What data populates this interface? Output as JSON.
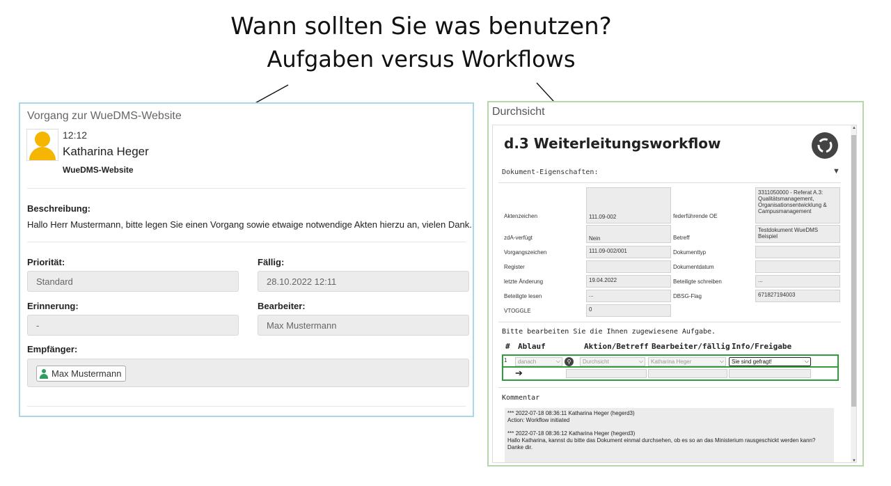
{
  "heading": {
    "line1": "Wann sollten Sie was benutzen?",
    "line2": "Aufgaben versus Workflows"
  },
  "left": {
    "panel_title": "Vorgang zur WueDMS-Website",
    "time": "12:12",
    "user": "Katharina Heger",
    "subject": "WueDMS-Website",
    "description_label": "Beschreibung:",
    "description": "Hallo Herr Mustermann, bitte legen Sie einen Vorgang sowie etwaige notwendige Akten hierzu an, vielen Dank.",
    "priority_label": "Priorität:",
    "priority": "Standard",
    "due_label": "Fällig:",
    "due": "28.10.2022 12:11",
    "reminder_label": "Erinnerung:",
    "reminder": "-",
    "editor_label": "Bearbeiter:",
    "editor": "Max Mustermann",
    "recipient_label": "Empfänger:",
    "recipient": "Max Mustermann",
    "accent_color": "#f5b500"
  },
  "right": {
    "panel_title": "Durchsicht",
    "workflow_title": "d.3 Weiterleitungsworkflow",
    "doc_props_label": "Dokument-Eigenschaften:",
    "props": {
      "aktenzeichen_label": "Aktenzeichen",
      "aktenzeichen": "111.09-002",
      "oe_label": "federführende OE",
      "oe": "3311050000 - Referat A.3: Qualitätsmanagement, Organisationsentwicklung & Campusmanagement",
      "zda_label": "zdA-verfügt",
      "zda": "Nein",
      "betreff_label": "Betreff",
      "betreff": "Testdokument WueDMS Beispiel",
      "vorgang_label": "Vorgangszeichen",
      "vorgang": "111.09-002/001",
      "doktyp_label": "Dokumenttyp",
      "register_label": "Register",
      "dokdatum_label": "Dokumentdatum",
      "aenderung_label": "letzte Änderung",
      "aenderung": "19.04.2022",
      "schreiben_label": "Beteiligte schreiben",
      "schreiben": "...",
      "lesen_label": "Beteiligte lesen",
      "lesen": "...",
      "dbsg_label": "DBSG-Flag",
      "dbsg": "671827194003",
      "vtoggle_label": "VTOGGLE",
      "vtoggle": "0"
    },
    "task_prompt": "Bitte bearbeiten Sie die Ihnen zugewiesene Aufgabe.",
    "table_headers": [
      "#",
      "Ablauf",
      "Aktion/Betreff",
      "Bearbeiter/fällig",
      "Info/Freigabe"
    ],
    "row": {
      "num": "1",
      "ablauf": "danach",
      "aktion": "Durchsicht",
      "bearbeiter": "Katharina Heger",
      "info": "Sie sind gefragt!"
    },
    "comment_label": "Kommentar",
    "comments": [
      "*** 2022-07-18 08:36:11 Katharina Heger (hegerd3)",
      "Action: Workflow initiated",
      "*** 2022-07-18 08:36:12 Katharina Heger (hegerd3)",
      "Hallo Katharina, kannst du bitte das Dokument einmal durchsehen, ob es so an das Ministerium rausgeschickt werden kann?",
      "Danke dir."
    ],
    "highlight_color": "#2e9e3a"
  }
}
